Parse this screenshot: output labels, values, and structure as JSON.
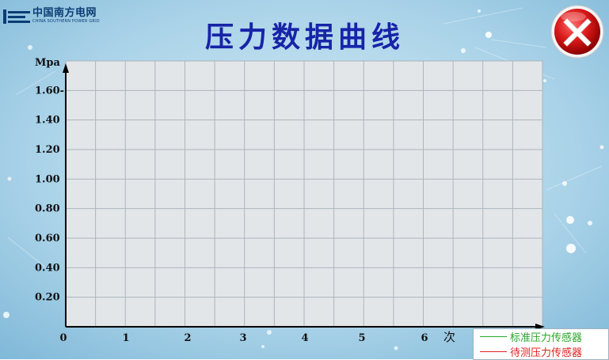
{
  "logo": {
    "cn": "中国南方电网",
    "en": "CHINA SOUTHERN POWER GRID"
  },
  "title": "压力数据曲线",
  "close_icon": "close-icon",
  "colors": {
    "title": "#1723a8",
    "standard": "#2aa52a",
    "test": "#e02020"
  },
  "chart_data": {
    "type": "line",
    "title": "压力数据曲线",
    "ylabel": "Mpa",
    "xlabel": "次",
    "x_ticks": [
      "0",
      "1",
      "2",
      "3",
      "4",
      "5",
      "6"
    ],
    "y_ticks": [
      "1.60-",
      "1.40",
      "1.20",
      "1.00",
      "0.80",
      "0.60",
      "0.40",
      "0.20"
    ],
    "ylim": [
      0,
      1.8
    ],
    "xlim": [
      0,
      8
    ],
    "grid": true,
    "legend_position": "bottom-right",
    "series": [
      {
        "name": "标准压力传感器",
        "color": "#2aa52a",
        "values": []
      },
      {
        "name": "待测压力传感器",
        "color": "#e02020",
        "values": []
      }
    ]
  }
}
